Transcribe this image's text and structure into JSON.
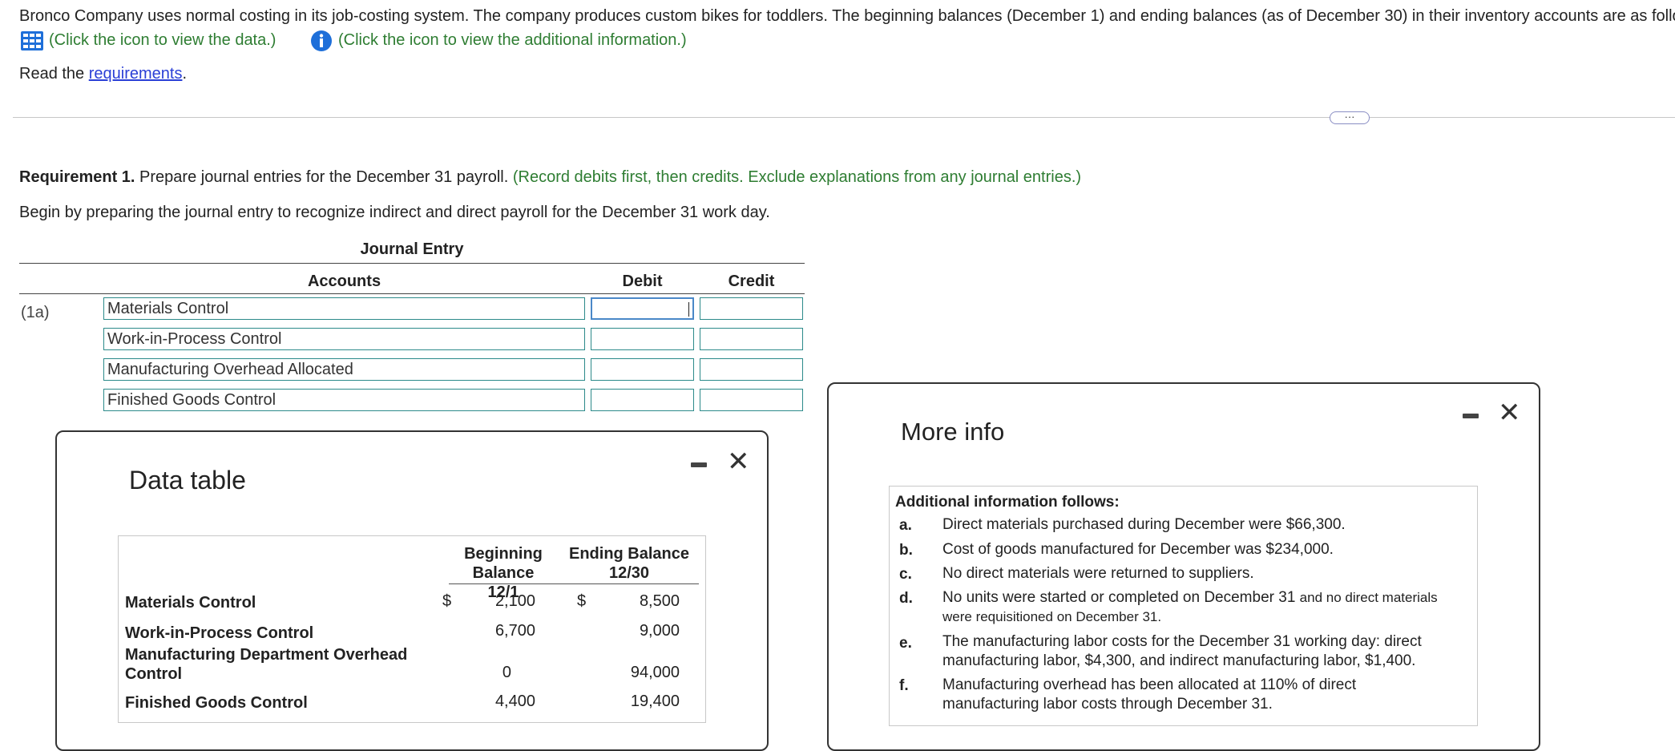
{
  "problem": {
    "intro": "Bronco Company uses normal costing in its job-costing system. The company produces custom bikes for toddlers. The beginning balances (December 1) and ending balances (as of December 30) in their inventory accounts are as follows:",
    "data_link": "(Click the icon to view the data.)",
    "info_link": "(Click the icon to view the additional information.)",
    "read_prefix": "Read the ",
    "requirements_link": "requirements",
    "read_suffix": ".",
    "expand_label": "···"
  },
  "requirement": {
    "label": "Requirement 1.",
    "text": " Prepare journal entries for the December 31 payroll.",
    "instruction": " (Record debits first, then credits. Exclude explanations from any journal entries.)",
    "begin_text": "Begin by preparing the journal entry to recognize indirect and direct payroll for the December 31 work day."
  },
  "journal": {
    "title": "Journal Entry",
    "col_accounts": "Accounts",
    "col_debit": "Debit",
    "col_credit": "Credit",
    "entry_label": "(1a)",
    "rows": [
      {
        "account": "Materials Control",
        "debit": "",
        "credit": ""
      },
      {
        "account": "Work-in-Process Control",
        "debit": "",
        "credit": ""
      },
      {
        "account": "Manufacturing Overhead Allocated",
        "debit": "",
        "credit": ""
      },
      {
        "account": "Finished Goods Control",
        "debit": "",
        "credit": ""
      }
    ]
  },
  "data_popup": {
    "title": "Data table",
    "col_begin_line1": "Beginning",
    "col_begin_line2": "Balance 12/1",
    "col_end_line1": "Ending Balance",
    "col_end_line2": "12/30",
    "currency": "$",
    "rows": [
      {
        "label": "Materials Control",
        "label2": "",
        "begin": "2,100",
        "end": "8,500"
      },
      {
        "label": "Work-in-Process Control",
        "label2": "",
        "begin": "6,700",
        "end": "9,000"
      },
      {
        "label": "Manufacturing Department Overhead",
        "label2": "Control",
        "begin": "0",
        "end": "94,000"
      },
      {
        "label": "Finished Goods Control",
        "label2": "",
        "begin": "4,400",
        "end": "19,400"
      }
    ]
  },
  "info_popup": {
    "title": "More info",
    "heading": "Additional information follows:",
    "items": [
      {
        "letter": "a.",
        "text": "Direct materials purchased during December were $66,300."
      },
      {
        "letter": "b.",
        "text": "Cost of goods manufactured for December was $234,000."
      },
      {
        "letter": "c.",
        "text": "No direct materials were returned to suppliers."
      },
      {
        "letter": "d.",
        "text_a": "No units were started or completed on December 31 ",
        "text_b": "and no direct materials",
        "text_c": "were requisitioned on December 31."
      },
      {
        "letter": "e.",
        "text": "The manufacturing labor costs for the December 31 working day: direct manufacturing labor, $4,300, and indirect manufacturing labor, $1,400."
      },
      {
        "letter": "f.",
        "text": "Manufacturing overhead has been allocated at 110% of direct manufacturing labor costs through December 31."
      }
    ]
  },
  "colors": {
    "green_text": "#2e7d32",
    "link_blue": "#2a3fd6",
    "input_border": "#2c8a8a",
    "focus_border": "#4a88c8",
    "icon_blue": "#1e6fd9"
  }
}
